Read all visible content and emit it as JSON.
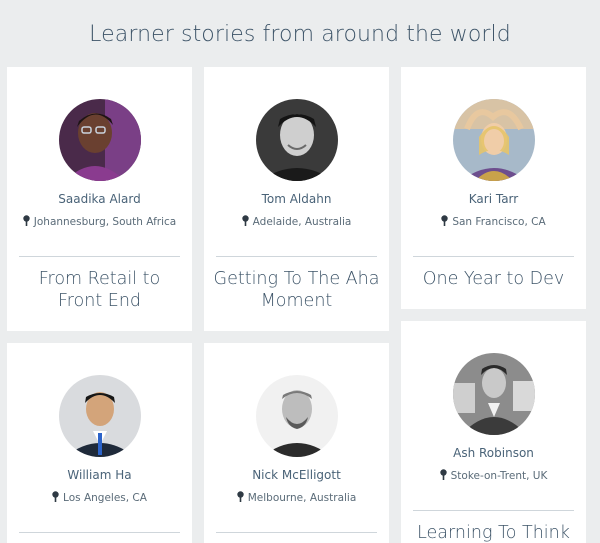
{
  "heading": "Learner stories from around the world",
  "stories": [
    {
      "name": "Saadika Alard",
      "location": "Johannesburg, South Africa",
      "title": "From Retail to Front End"
    },
    {
      "name": "Tom Aldahn",
      "location": "Adelaide, Australia",
      "title": "Getting To The Aha Moment"
    },
    {
      "name": "Kari Tarr",
      "location": "San Francisco, CA",
      "title": "One Year to Dev"
    },
    {
      "name": "William Ha",
      "location": "Los Angeles, CA",
      "title": ""
    },
    {
      "name": "Nick McElligott",
      "location": "Melbourne, Australia",
      "title": ""
    },
    {
      "name": "Ash Robinson",
      "location": "Stoke-on-Trent, UK",
      "title": "Learning To Think"
    }
  ],
  "icons": {
    "avatar": "person-photo",
    "location": "map-pin-icon"
  },
  "colors": {
    "background": "#ebedee",
    "card": "#ffffff",
    "heading": "#3d5468",
    "divider": "#cfd6db"
  }
}
